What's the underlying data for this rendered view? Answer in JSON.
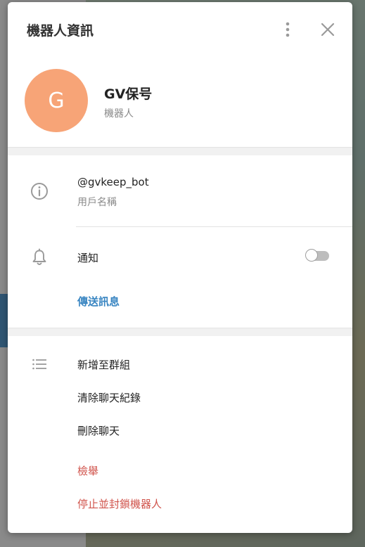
{
  "dialog": {
    "title": "機器人資訊"
  },
  "profile": {
    "avatar_initial": "G",
    "avatar_color": "#f7a477",
    "name": "GV保号",
    "subtitle": "機器人"
  },
  "info": {
    "username": "@gvkeep_bot",
    "username_caption": "用戶名稱"
  },
  "notifications": {
    "label": "通知",
    "enabled": false
  },
  "send_message_label": "傳送訊息",
  "actions": [
    {
      "label": "新增至群組",
      "danger": false
    },
    {
      "label": "清除聊天紀錄",
      "danger": false
    },
    {
      "label": "刪除聊天",
      "danger": false
    },
    {
      "label": "檢舉",
      "danger": true
    },
    {
      "label": "停止並封鎖機器人",
      "danger": true
    }
  ],
  "icons": {
    "more": "more-vertical-icon",
    "close": "close-icon",
    "info": "info-icon",
    "bell": "bell-icon",
    "list": "list-icon"
  },
  "colors": {
    "accent": "#3a86c2",
    "danger": "#d0534b"
  }
}
